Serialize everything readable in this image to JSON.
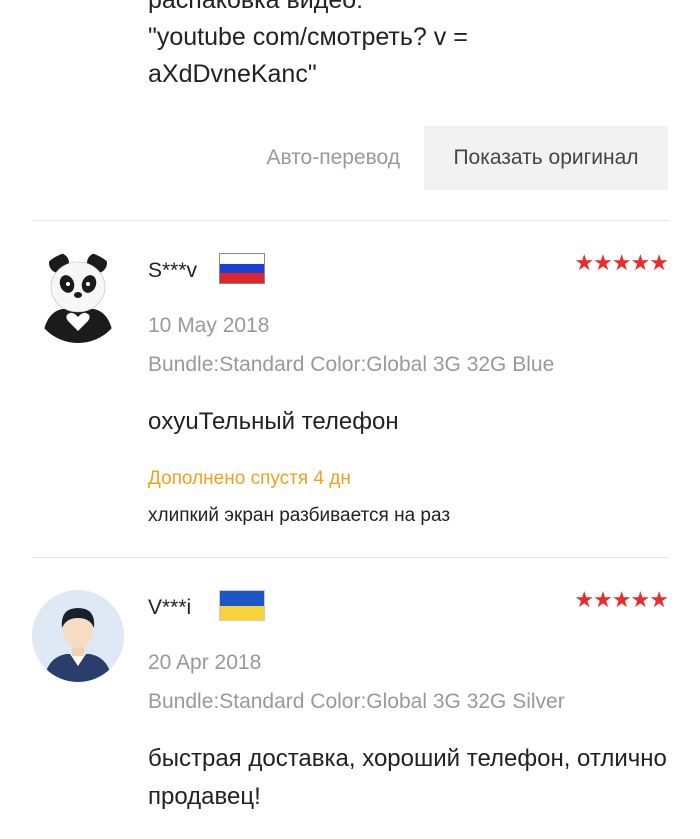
{
  "previous_review": {
    "lines": [
      "распаковка видео:",
      "\"youtube com/смотреть? v =",
      "aXdDvneKanc\""
    ]
  },
  "translate": {
    "auto_label": "Авто-перевод",
    "original_label": "Показать оригинал"
  },
  "reviews": [
    {
      "name": "S***v",
      "flag": "russia-flag",
      "stars": "★★★★★",
      "rating": 5,
      "date": "10 May 2018",
      "variant": "Bundle:Standard Color:Global 3G 32G Blue",
      "text": "oxyuТельный телефон",
      "additional_label": "Дополнено спустя 4 дн",
      "additional_text": "хлипкий экран разбивается на раз"
    },
    {
      "name": "V***i",
      "flag": "ukraine-flag",
      "stars": "★★★★★",
      "rating": 5,
      "date": "20 Apr 2018",
      "variant": "Bundle:Standard Color:Global 3G 32G Silver",
      "text": "быстрая доставка, хороший телефон, отлично продавец!"
    }
  ],
  "colors": {
    "star": "#e62e2e",
    "additional_label": "#f0a020",
    "muted_text": "#999999",
    "button_bg": "#f2f2f2"
  }
}
